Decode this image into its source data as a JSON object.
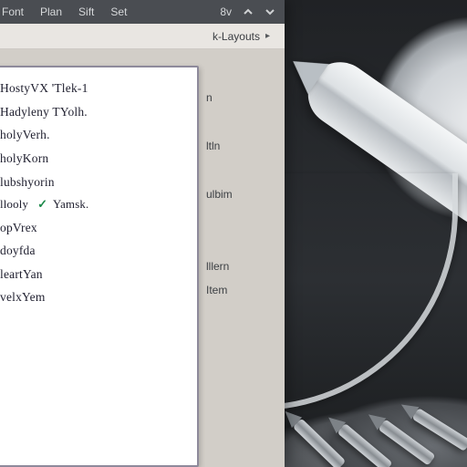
{
  "menubar": {
    "items": [
      "Font",
      "Plan",
      "Sift",
      "Set"
    ],
    "page": "8v"
  },
  "submenu": {
    "label": "k-Layouts",
    "chevron": "▸"
  },
  "panel": {
    "items": [
      {
        "text": "HostyVX 'Tlek-1"
      },
      {
        "text": "Hadyleny TYolh."
      },
      {
        "text": "holyVerh."
      },
      {
        "text": "holyKorn"
      },
      {
        "text": "lubshyorin"
      },
      {
        "text": "llooly",
        "tick": "✓",
        "text2": "Yamsk."
      },
      {
        "text": "opVrex"
      },
      {
        "text": "doyfda"
      },
      {
        "text": "leartYan"
      },
      {
        "text": "velxYem"
      }
    ]
  },
  "sidecol": {
    "items": [
      "",
      "n",
      "",
      "ltln",
      "",
      "ulbim",
      "",
      "",
      "lllern",
      "Item"
    ]
  }
}
